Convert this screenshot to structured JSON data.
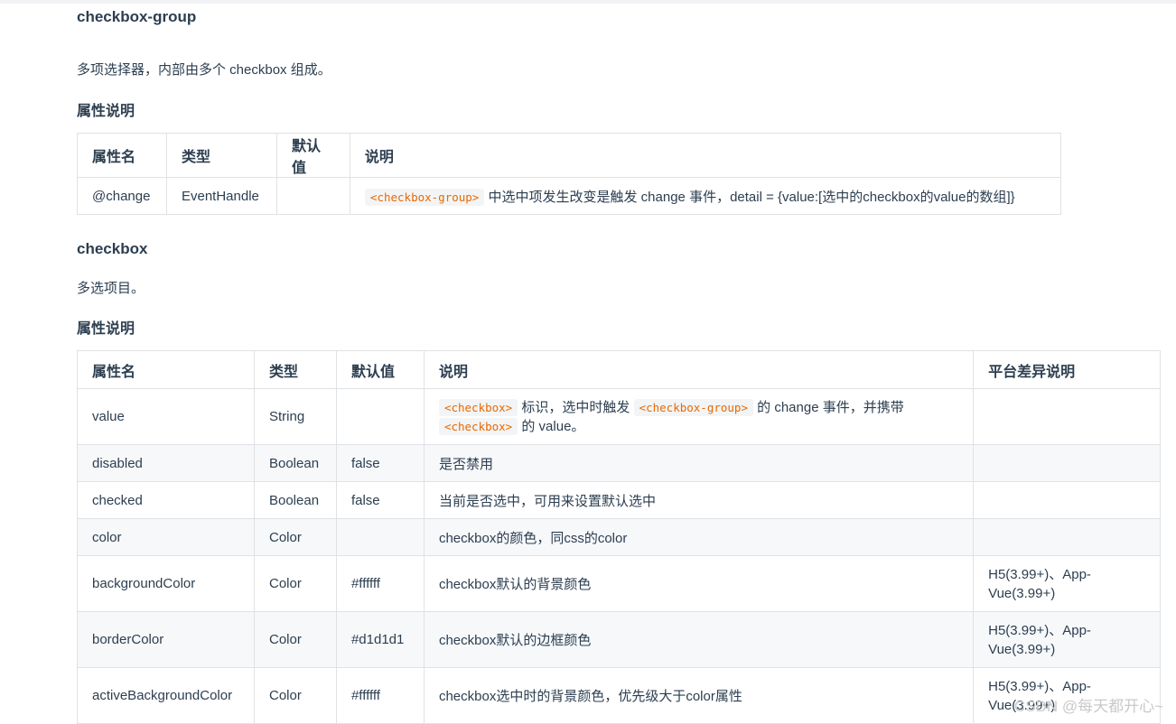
{
  "section1": {
    "title": "checkbox-group",
    "desc": "多项选择器，内部由多个 checkbox 组成。",
    "props_heading": "属性说明",
    "headers": [
      "属性名",
      "类型",
      "默认值",
      "说明"
    ],
    "row": {
      "name": "@change",
      "type": "EventHandle",
      "default": "",
      "code": "<checkbox-group>",
      "desc": "中选中项发生改变是触发 change 事件，detail = {value:[选中的checkbox的value的数组]}"
    }
  },
  "section2": {
    "title": "checkbox",
    "desc": "多选项目。",
    "props_heading": "属性说明",
    "headers": [
      "属性名",
      "类型",
      "默认值",
      "说明",
      "平台差异说明"
    ],
    "value_row": {
      "name": "value",
      "type": "String",
      "default": "",
      "code1": "<checkbox>",
      "text1": "标识，选中时触发",
      "code2": "<checkbox-group>",
      "text2": "的 change 事件，并携带",
      "code3": "<checkbox>",
      "text3": "的 value。",
      "platform": ""
    },
    "rows": [
      {
        "name": "disabled",
        "type": "Boolean",
        "default": "false",
        "desc": "是否禁用",
        "platform": ""
      },
      {
        "name": "checked",
        "type": "Boolean",
        "default": "false",
        "desc": "当前是否选中，可用来设置默认选中",
        "platform": ""
      },
      {
        "name": "color",
        "type": "Color",
        "default": "",
        "desc": "checkbox的颜色，同css的color",
        "platform": ""
      },
      {
        "name": "backgroundColor",
        "type": "Color",
        "default": "#ffffff",
        "desc": "checkbox默认的背景颜色",
        "platform": "H5(3.99+)、App-Vue(3.99+)"
      },
      {
        "name": "borderColor",
        "type": "Color",
        "default": "#d1d1d1",
        "desc": "checkbox默认的边框颜色",
        "platform": "H5(3.99+)、App-Vue(3.99+)"
      },
      {
        "name": "activeBackgroundColor",
        "type": "Color",
        "default": "#ffffff",
        "desc": "checkbox选中时的背景颜色，优先级大于color属性",
        "platform": "H5(3.99+)、App-Vue(3.99+)"
      }
    ]
  },
  "watermark": "CSDN @每天都开心~"
}
